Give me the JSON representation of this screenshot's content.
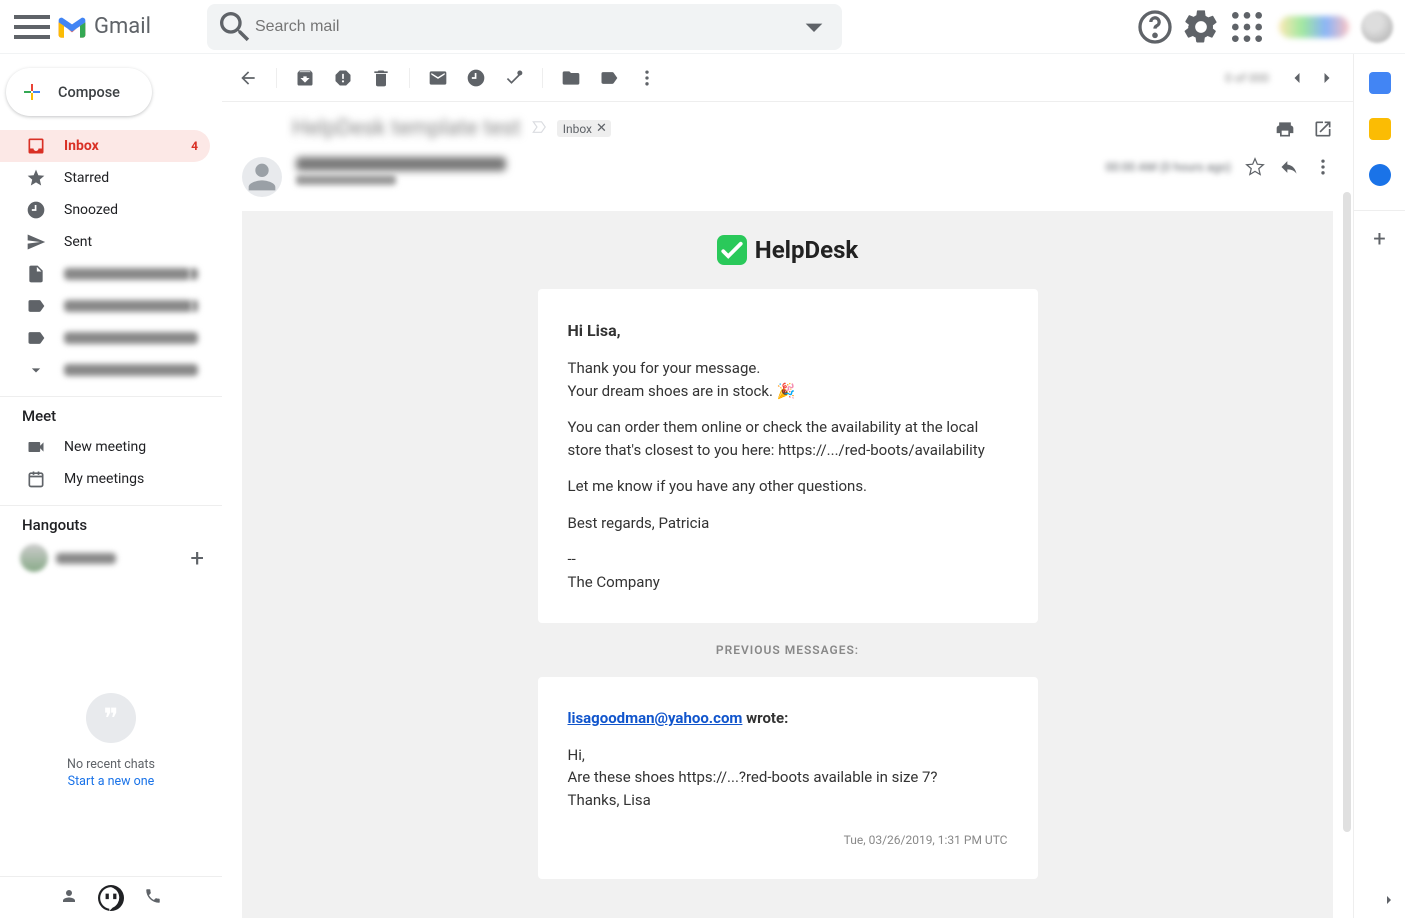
{
  "header": {
    "product_name": "Gmail",
    "search_placeholder": "Search mail"
  },
  "sidebar": {
    "compose_label": "Compose",
    "items": [
      {
        "label": "Inbox",
        "count": "4",
        "icon": "inbox"
      },
      {
        "label": "Starred",
        "icon": "star"
      },
      {
        "label": "Snoozed",
        "icon": "clock"
      },
      {
        "label": "Sent",
        "icon": "send"
      }
    ],
    "meet_header": "Meet",
    "meet_items": [
      {
        "label": "New meeting",
        "icon": "video"
      },
      {
        "label": "My meetings",
        "icon": "calendar"
      }
    ],
    "hangouts_header": "Hangouts",
    "no_chats_text": "No recent chats",
    "start_new_link": "Start a new one"
  },
  "thread": {
    "inbox_chip": "Inbox",
    "previous_messages_label": "PREVIOUS MESSAGES:",
    "helpdesk_brand": "HelpDesk",
    "body": {
      "greeting": "Hi Lisa,",
      "line1": "Thank you for your message.",
      "line2": "Your dream shoes are in stock. 🎉",
      "line3": "You can order them online or check the availability at the local store that's closest to you here: https://.../red-boots/availability",
      "line4": "Let me know if you have any other questions.",
      "signoff": "Best regards, Patricia",
      "divider": "--",
      "company": "The Company"
    },
    "reply": {
      "from_email": "lisagoodman@yahoo.com",
      "wrote_suffix": " wrote:",
      "line1": "Hi,",
      "line2": "Are these shoes https://...?red-boots available in size 7?",
      "line3": "Thanks, Lisa",
      "timestamp": "Tue, 03/26/2019, 1:31 PM UTC"
    }
  }
}
